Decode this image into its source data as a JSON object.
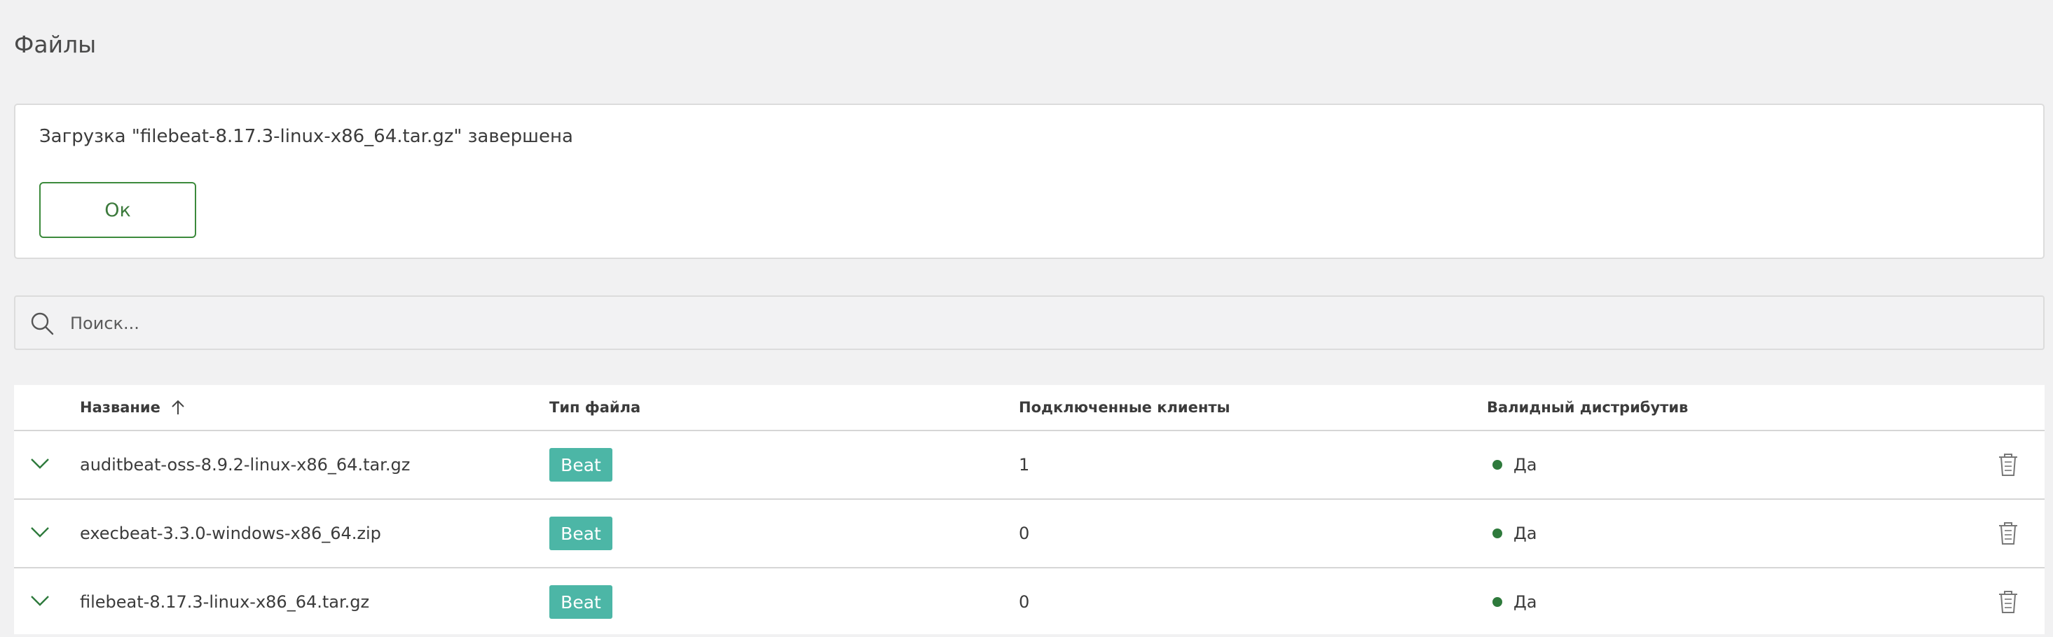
{
  "page": {
    "title": "Файлы"
  },
  "notice": {
    "message": "Загрузка \"filebeat-8.17.3-linux-x86_64.tar.gz\" завершена",
    "ok_label": "Ок"
  },
  "search": {
    "placeholder": "Поиск..."
  },
  "table": {
    "columns": {
      "name": "Название",
      "type": "Тип файла",
      "clients": "Подключенные клиенты",
      "valid": "Валидный дистрибутив"
    },
    "sort": {
      "column": "name",
      "direction": "asc",
      "icon": "arrow-up-icon"
    },
    "rows": [
      {
        "name": "auditbeat-oss-8.9.2-linux-x86_64.tar.gz",
        "type": "Beat",
        "clients": "1",
        "valid": "Да"
      },
      {
        "name": "execbeat-3.3.0-windows-x86_64.zip",
        "type": "Beat",
        "clients": "0",
        "valid": "Да"
      },
      {
        "name": "filebeat-8.17.3-linux-x86_64.tar.gz",
        "type": "Beat",
        "clients": "0",
        "valid": "Да"
      }
    ]
  },
  "colors": {
    "background": "#f1f1f2",
    "accent_green": "#3c8a3c",
    "badge_teal": "#4cb6a6",
    "status_dot": "#2e7a3c"
  },
  "icons": {
    "search": "search-icon",
    "expand": "chevron-down-icon",
    "delete": "trash-icon"
  }
}
